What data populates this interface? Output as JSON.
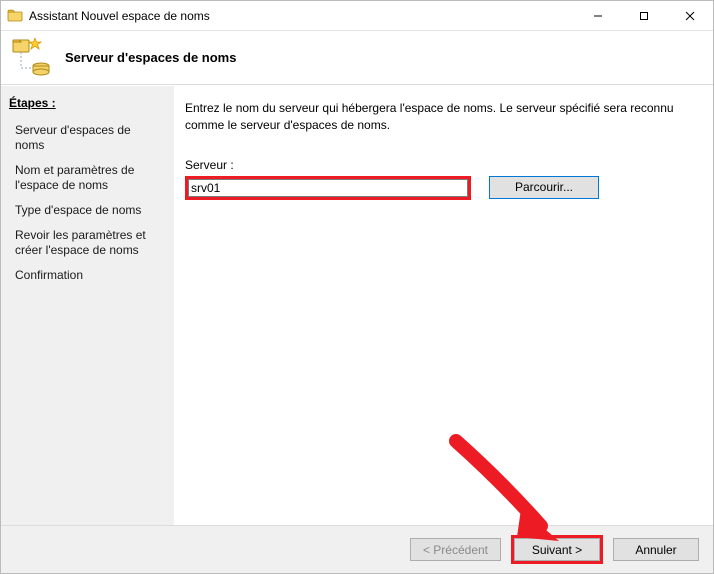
{
  "window": {
    "title": "Assistant Nouvel espace de noms"
  },
  "header": {
    "title": "Serveur d'espaces de noms"
  },
  "sidebar": {
    "heading": "Étapes :",
    "steps": [
      "Serveur d'espaces de noms",
      "Nom et paramètres de l'espace de noms",
      "Type d'espace de noms",
      "Revoir les paramètres et créer l'espace de noms",
      "Confirmation"
    ]
  },
  "content": {
    "instruction": "Entrez le nom du serveur qui hébergera l'espace de noms. Le serveur spécifié sera reconnu comme le serveur d'espaces de noms.",
    "server_label": "Serveur :",
    "server_value": "srv01",
    "browse_label": "Parcourir..."
  },
  "footer": {
    "previous": "< Précédent",
    "next": "Suivant >",
    "cancel": "Annuler"
  },
  "colors": {
    "highlight_red": "#ed1c24",
    "button_border_active": "#0078d7"
  }
}
